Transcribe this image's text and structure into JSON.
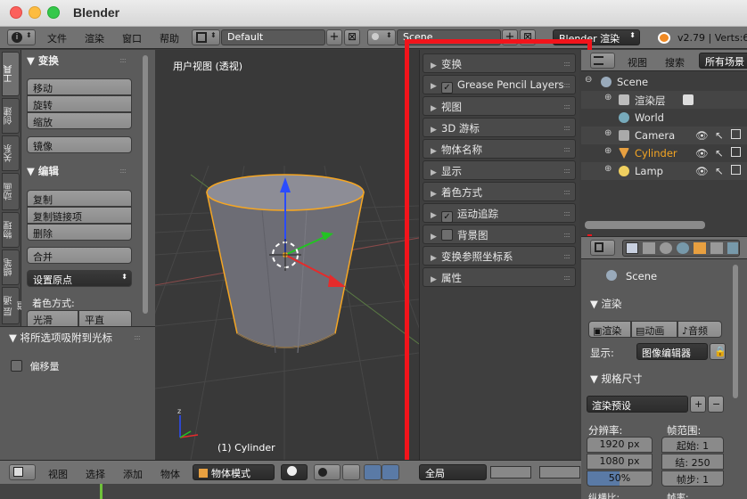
{
  "window": {
    "title": "Blender"
  },
  "info_header": {
    "menus": [
      "文件",
      "渲染",
      "窗口",
      "帮助"
    ],
    "screen_layout": "Default",
    "scene": "Scene",
    "render_engine": "Blender 渲染",
    "version_stats": "v2.79 | Verts:6"
  },
  "tool_tabs": [
    "工具",
    "创建",
    "关系",
    "动画",
    "物理",
    "蜡笔",
    "层 通道"
  ],
  "tools": {
    "transform_header": "▼ 变换",
    "transform_buttons": [
      "移动",
      "旋转",
      "缩放"
    ],
    "mirror_button": "镜像",
    "edit_header": "▼ 编辑",
    "edit_buttons": [
      "复制",
      "复制链接项",
      "删除"
    ],
    "join_button": "合并",
    "origin_dropdown": "设置原点",
    "shading_label": "着色方式:",
    "shading_buttons": [
      "光滑",
      "平直"
    ]
  },
  "snap_panel": {
    "header": "▼ 将所选项吸附到光标",
    "offset_label": "偏移量"
  },
  "viewport": {
    "view_label": "用户视图 (透视)",
    "object_label": "(1) Cylinder"
  },
  "n_panel": {
    "rows": [
      {
        "label": "变换",
        "checkbox": null
      },
      {
        "label": "Grease Pencil Layers",
        "checkbox": true
      },
      {
        "label": "视图",
        "checkbox": null
      },
      {
        "label": "3D 游标",
        "checkbox": null
      },
      {
        "label": "物体名称",
        "checkbox": null
      },
      {
        "label": "显示",
        "checkbox": null
      },
      {
        "label": "着色方式",
        "checkbox": null
      },
      {
        "label": "运动追踪",
        "checkbox": true
      },
      {
        "label": "背景图",
        "checkbox": false
      },
      {
        "label": "变换参照坐标系",
        "checkbox": null
      },
      {
        "label": "属性",
        "checkbox": null
      }
    ]
  },
  "outliner": {
    "menus": [
      "视图",
      "搜索"
    ],
    "filter": "所有场景",
    "items": [
      {
        "name": "Scene"
      },
      {
        "name": "渲染层"
      },
      {
        "name": "World"
      },
      {
        "name": "Camera"
      },
      {
        "name": "Cylinder"
      },
      {
        "name": "Lamp"
      }
    ]
  },
  "properties": {
    "scene_name": "Scene",
    "render_section": "渲染",
    "render_buttons": [
      "渲染",
      "动画",
      "音频"
    ],
    "display_label": "显示:",
    "display_value": "图像编辑器",
    "dimensions_section": "规格尺寸",
    "preset_dropdown": "渲染预设",
    "resolution_label": "分辨率:",
    "res_x": "1920 px",
    "res_y": "1080 px",
    "res_pct": "50%",
    "frame_range_label": "帧范围:",
    "frame_start": "起始: 1",
    "frame_end": "结: 250",
    "frame_step": "帧步: 1",
    "aspect_label": "纵横比:",
    "fps_label": "帧率:"
  },
  "bottom_header": {
    "menus": [
      "视图",
      "选择",
      "添加",
      "物体"
    ],
    "mode": "物体模式",
    "layer": "全局"
  },
  "colors": {
    "selection_outline": "#f5a623",
    "highlight_frame": "#f2141b"
  }
}
